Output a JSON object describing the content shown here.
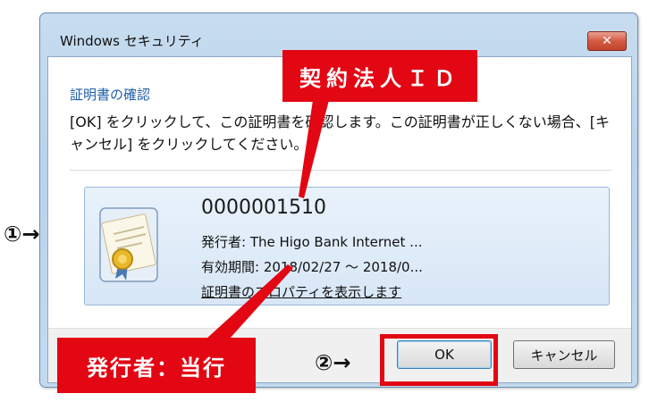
{
  "window": {
    "title": "Windows セキュリティ",
    "close_label": "✕"
  },
  "dialog": {
    "heading": "証明書の確認",
    "message": "[OK] をクリックして、この証明書を確認します。この証明書が正しくない場合、[キャンセル] をクリックしてください。"
  },
  "certificate": {
    "id": "0000001510",
    "issuer": "発行者: The Higo Bank Internet ...",
    "validity": "有効期間: 2018/02/27 ～ 2018/0...",
    "properties_link": "証明書のプロパティを表示します",
    "icon": "certificate-icon"
  },
  "buttons": {
    "ok": "OK",
    "cancel": "キャンセル"
  },
  "annotations": {
    "contract_label": "契約法人ＩＤ",
    "issuer_label": "発行者：当行",
    "marker_1": "①→",
    "marker_2": "②→",
    "highlight_color": "#e30613"
  }
}
